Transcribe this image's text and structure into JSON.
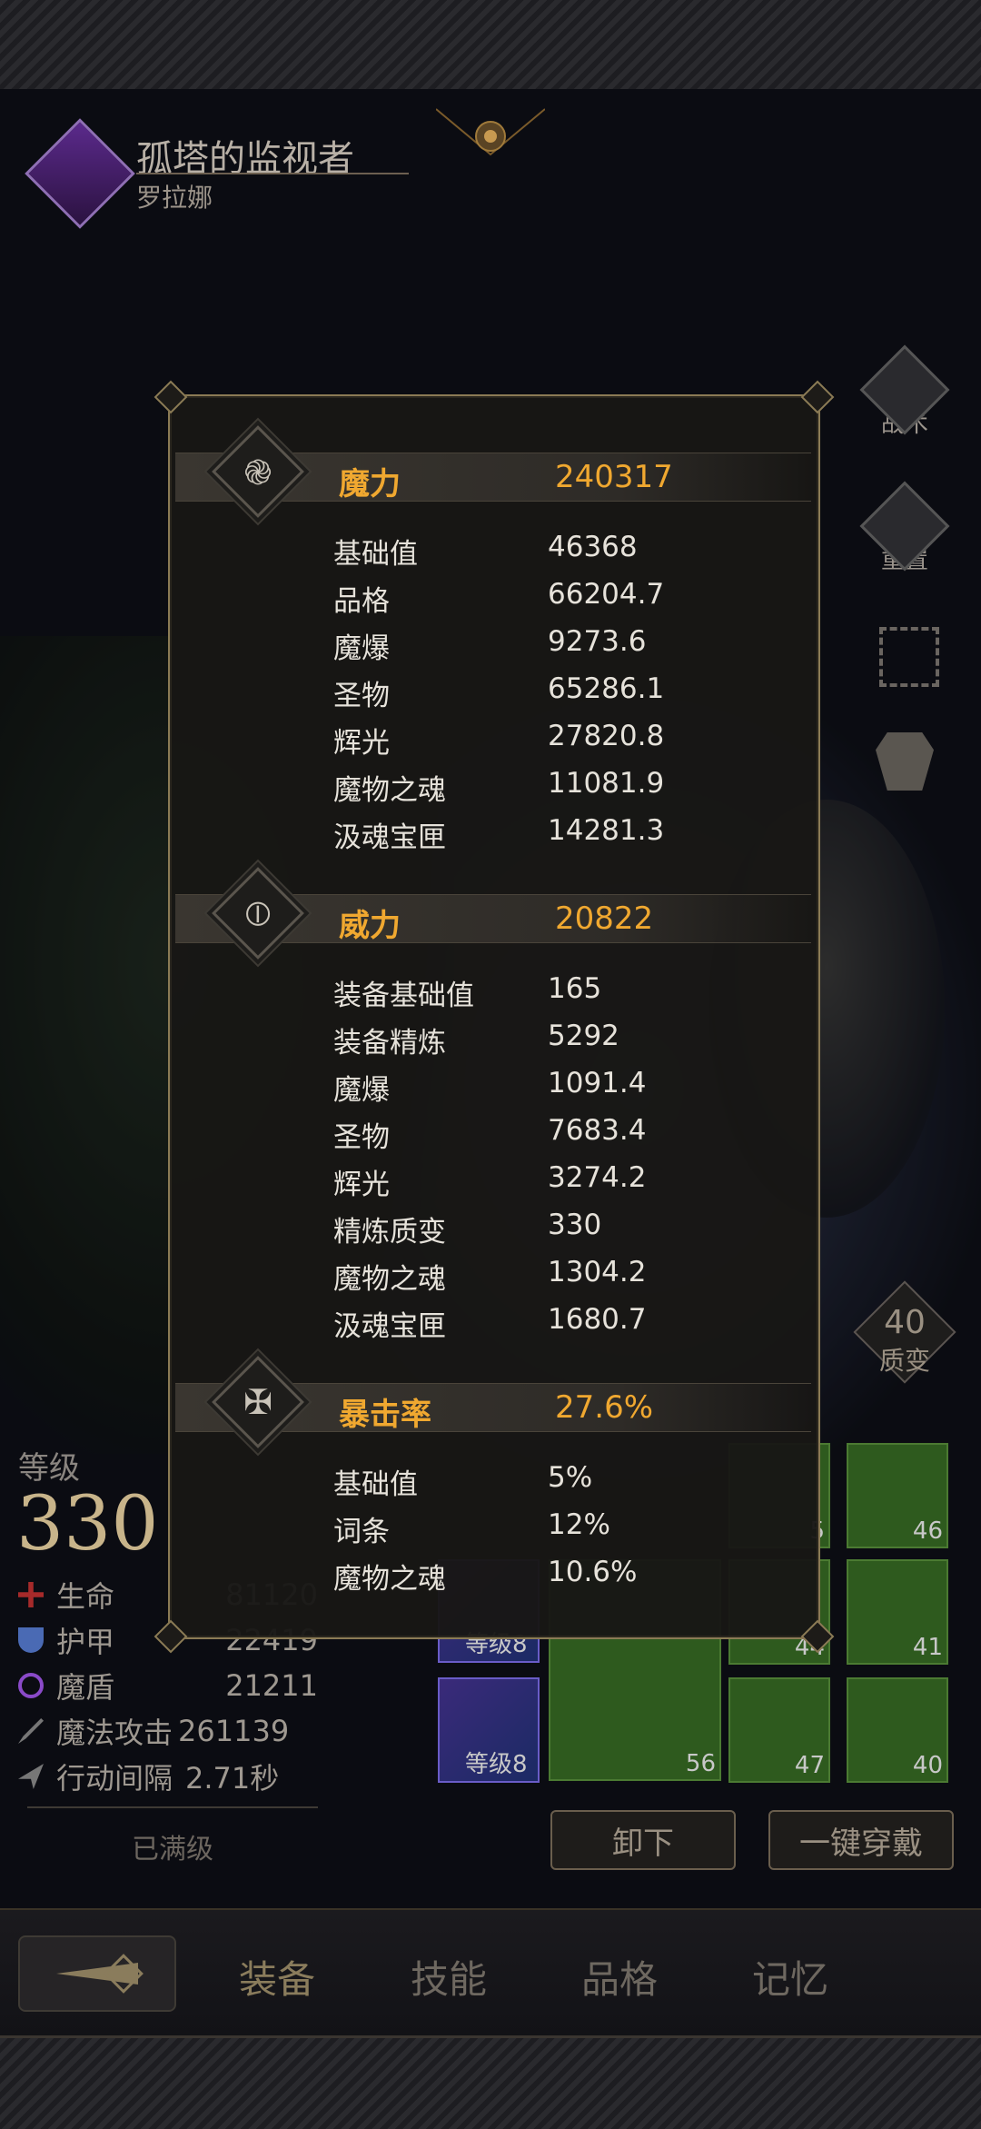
{
  "hero": {
    "title": "孤塔的监视者",
    "name": "罗拉娜"
  },
  "side_buttons": {
    "tactics": "战术",
    "reset": "重置"
  },
  "transmute": {
    "value": "40",
    "label": "质变"
  },
  "player": {
    "level_label": "等级",
    "level": "330",
    "stats": [
      {
        "label": "生命",
        "value": "81120"
      },
      {
        "label": "护甲",
        "value": "22419"
      },
      {
        "label": "魔盾",
        "value": "21211"
      },
      {
        "label": "魔法攻击",
        "value": "261139"
      },
      {
        "label": "行动间隔",
        "value": "2.71秒"
      }
    ],
    "maxed_label": "已满级"
  },
  "equipment": {
    "slots": [
      "5",
      "46",
      "44",
      "41",
      "56",
      "47",
      "40"
    ],
    "rune_levels": [
      "等级8",
      "等级8"
    ],
    "unequip_label": "卸下",
    "equip_all_label": "一键穿戴"
  },
  "tabs": [
    "装备",
    "技能",
    "品格",
    "记忆"
  ],
  "popup": {
    "sections": [
      {
        "name": "魔力",
        "value": "240317",
        "rows": [
          {
            "label": "基础值",
            "value": "46368"
          },
          {
            "label": "品格",
            "value": "66204.7"
          },
          {
            "label": "魔爆",
            "value": "9273.6"
          },
          {
            "label": "圣物",
            "value": "65286.1"
          },
          {
            "label": "辉光",
            "value": "27820.8"
          },
          {
            "label": "魔物之魂",
            "value": "11081.9"
          },
          {
            "label": "汲魂宝匣",
            "value": "14281.3"
          }
        ]
      },
      {
        "name": "威力",
        "value": "20822",
        "rows": [
          {
            "label": "装备基础值",
            "value": "165"
          },
          {
            "label": "装备精炼",
            "value": "5292"
          },
          {
            "label": "魔爆",
            "value": "1091.4"
          },
          {
            "label": "圣物",
            "value": "7683.4"
          },
          {
            "label": "辉光",
            "value": "3274.2"
          },
          {
            "label": "精炼质变",
            "value": "330"
          },
          {
            "label": "魔物之魂",
            "value": "1304.2"
          },
          {
            "label": "汲魂宝匣",
            "value": "1680.7"
          }
        ]
      },
      {
        "name": "暴击率",
        "value": "27.6%",
        "rows": [
          {
            "label": "基础值",
            "value": "5%"
          },
          {
            "label": "词条",
            "value": "12%"
          },
          {
            "label": "魔物之魂",
            "value": "10.6%"
          }
        ]
      }
    ]
  },
  "colors": {
    "accent": "#f0a830",
    "popup_border": "#8b7b55"
  }
}
